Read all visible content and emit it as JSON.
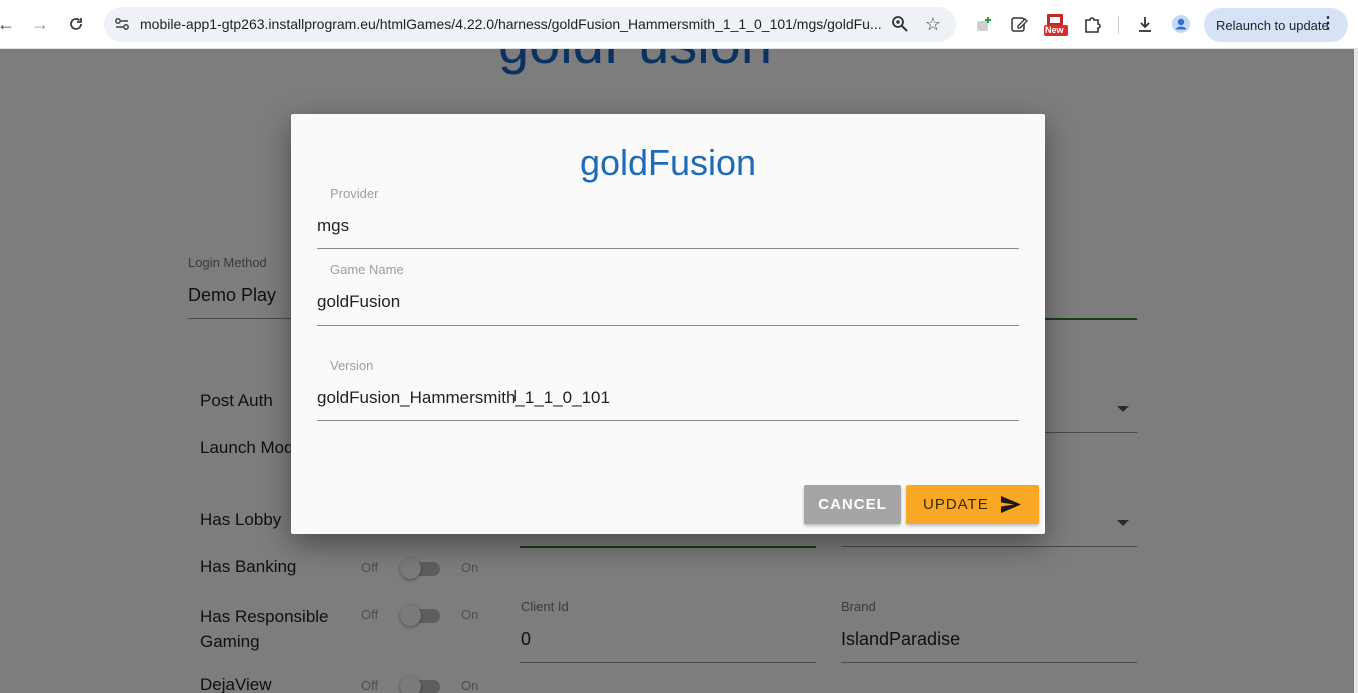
{
  "browser": {
    "url": "mobile-app1-gtp263.installprogram.eu/htmlGames/4.22.0/harness/goldFusion_Hammersmith_1_1_0_101/mgs/goldFu...",
    "relaunch_label": "Relaunch to update",
    "extension_badge": "New"
  },
  "page": {
    "title": "goldFusion",
    "login_method_label": "Login Method",
    "login_method_value": "Demo Play",
    "post_auth_label": "Post Auth",
    "launch_mode_label": "Launch Mod",
    "has_lobby_label": "Has Lobby",
    "has_banking_label": "Has Banking",
    "has_responsible_gaming_label": "Has Responsible Gaming",
    "dejaview_label": "DejaView",
    "toggle_off": "Off",
    "toggle_on": "On",
    "client_id_label": "Client Id",
    "client_id_value": "0",
    "brand_label": "Brand",
    "brand_value": "IslandParadise"
  },
  "dialog": {
    "title": "goldFusion",
    "provider_label": "Provider",
    "provider_value": "mgs",
    "game_name_label": "Game Name",
    "game_name_value": "goldFusion",
    "version_label": "Version",
    "version_value": "goldFusion_Hammersmith_1_1_0_101",
    "cancel_label": "CANCEL",
    "update_label": "UPDATE"
  },
  "colors": {
    "title_blue": "#1e6bb8",
    "update_orange": "#f9a825",
    "cancel_grey": "#a5a5a5"
  }
}
